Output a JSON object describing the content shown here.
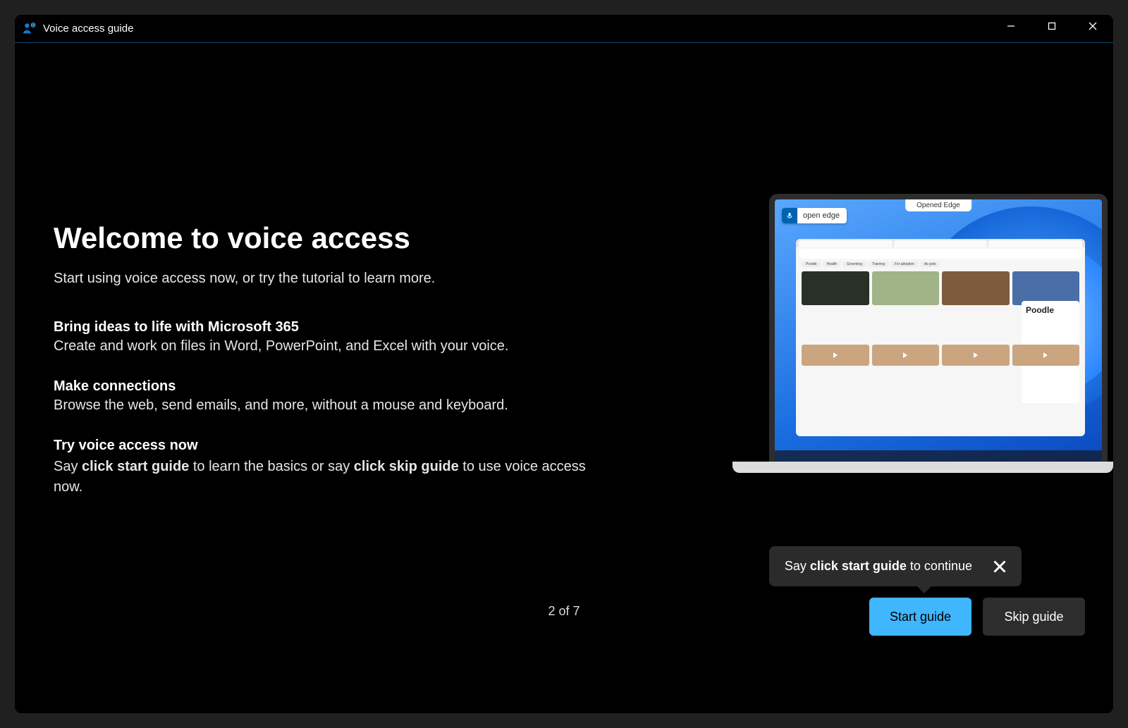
{
  "titlebar": {
    "app_title": "Voice access guide"
  },
  "main": {
    "title": "Welcome to voice access",
    "subtitle": "Start using voice access now, or try the tutorial to learn more.",
    "blocks": [
      {
        "heading": "Bring ideas to life with Microsoft 365",
        "body": "Create and work on files in Word, PowerPoint, and Excel with your voice."
      },
      {
        "heading": "Make connections",
        "body": "Browse the web, send emails, and more, without a mouse and keyboard."
      }
    ],
    "try_heading": "Try voice access now",
    "try_pre": "Say ",
    "try_cmd1": "click start guide",
    "try_mid": " to learn the basics or say ",
    "try_cmd2": "click skip guide",
    "try_post": " to use voice access now."
  },
  "illustration": {
    "top_badge": "Opened Edge",
    "voice_badge": "open edge",
    "side_card_title": "Poodle"
  },
  "pager": "2 of 7",
  "tooltip": {
    "pre": "Say ",
    "bold": "click start guide",
    "post": " to continue"
  },
  "buttons": {
    "start": "Start guide",
    "skip": "Skip guide"
  },
  "colors": {
    "primary": "#40b6ff"
  }
}
